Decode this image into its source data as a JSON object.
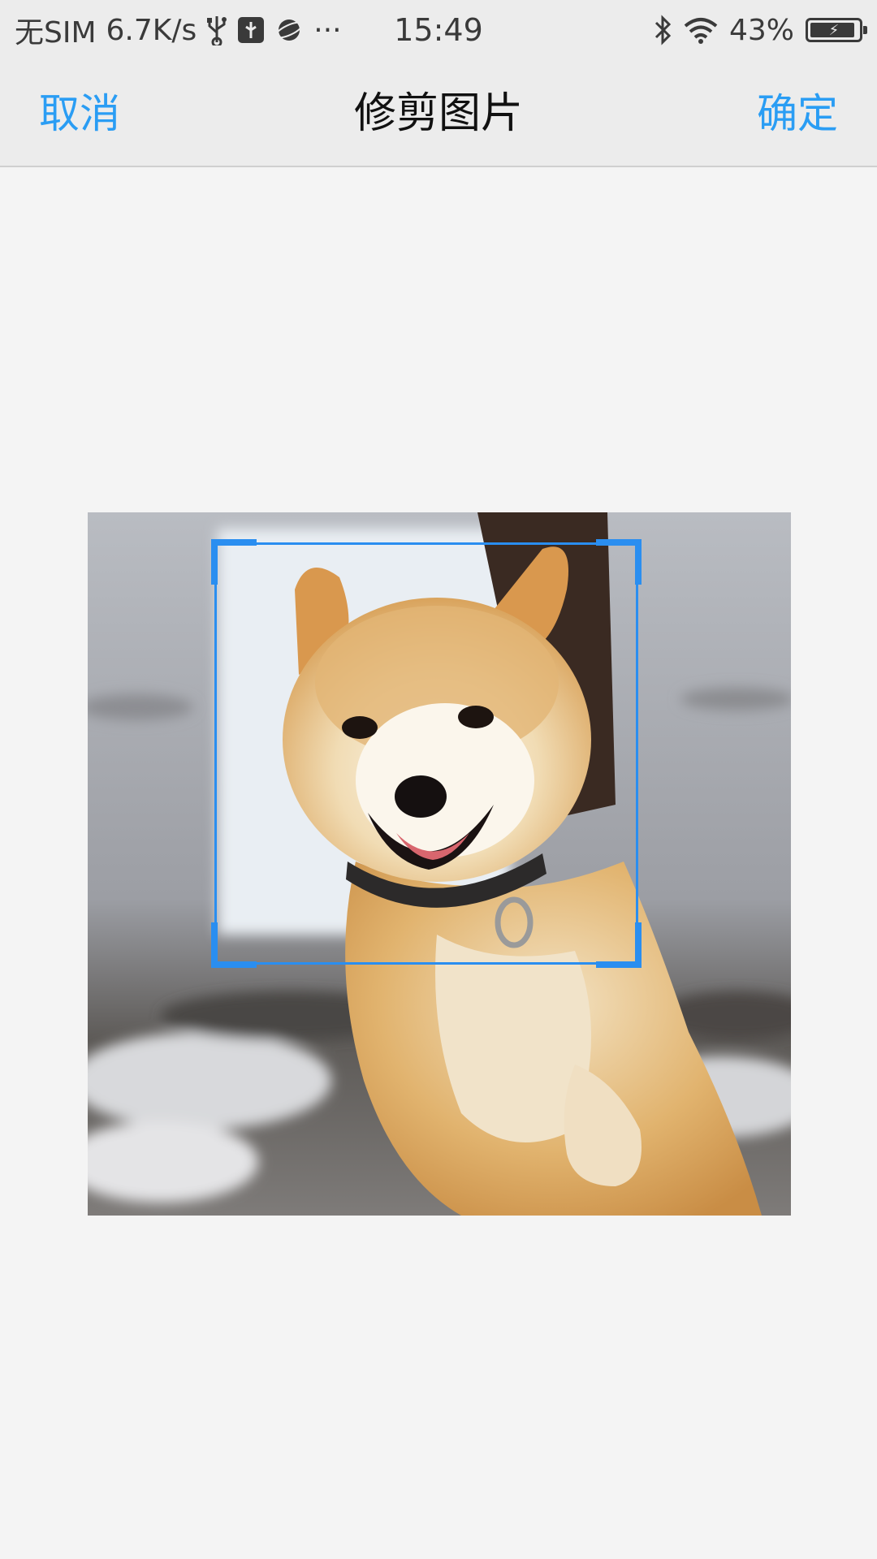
{
  "status_bar": {
    "carrier": "无SIM",
    "speed": "6.7K/s",
    "more": "···",
    "time": "15:49",
    "battery": "43%",
    "icons": [
      "usb-icon",
      "usb-debug-icon",
      "browser-icon",
      "bluetooth-icon",
      "wifi-icon",
      "battery-charging-icon"
    ]
  },
  "nav": {
    "cancel_label": "取消",
    "title": "修剪图片",
    "confirm_label": "确定"
  },
  "editor": {
    "image_subject": "shiba-inu-dog-photo",
    "accent_color": "#2a8ef0"
  }
}
